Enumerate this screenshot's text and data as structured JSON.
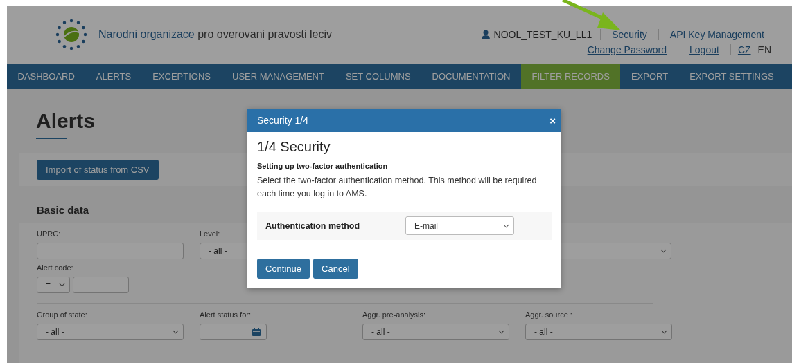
{
  "header": {
    "title_highlight": "Narodni organizace",
    "title_rest": "pro overovani pravosti leciv",
    "user": "NOOL_TEST_KU_LL1",
    "links_top": [
      "Security",
      "API Key Management"
    ],
    "links_bottom": [
      "Change Password",
      "Logout"
    ],
    "languages": [
      {
        "label": "CZ",
        "selected": false
      },
      {
        "label": "EN",
        "selected": true
      }
    ]
  },
  "nav": [
    {
      "label": "DASHBOARD",
      "selected": false
    },
    {
      "label": "ALERTS",
      "selected": false
    },
    {
      "label": "EXCEPTIONS",
      "selected": false
    },
    {
      "label": "USER MANAGEMENT",
      "selected": false
    },
    {
      "label": "SET COLUMNS",
      "selected": false
    },
    {
      "label": "DOCUMENTATION",
      "selected": false
    },
    {
      "label": "FILTER RECORDS",
      "selected": true
    },
    {
      "label": "EXPORT",
      "selected": false
    },
    {
      "label": "EXPORT SETTINGS",
      "selected": false
    }
  ],
  "page": {
    "title": "Alerts",
    "import_button": "Import of status from CSV",
    "section": "Basic data",
    "uprc": {
      "label": "UPRC:"
    },
    "level": {
      "label": "Level:",
      "value": "- all -"
    },
    "alert_code": {
      "label": "Alert code:",
      "operator": "="
    },
    "filters": [
      {
        "kind": "select",
        "label": "Group of state:",
        "value": "- all -"
      },
      {
        "kind": "date",
        "label": "Alert status for:"
      },
      {
        "kind": "select",
        "label": "Aggr. pre-analysis:",
        "value": "- all -"
      },
      {
        "kind": "select",
        "label": "Aggr. source :",
        "value": "- all -"
      }
    ]
  },
  "dialog": {
    "title": "Security 1/4",
    "close": "×",
    "heading": "1/4 Security",
    "subheading": "Setting up two-factor authentication",
    "text": "Select the two-factor authentication method. This method will be required each time you log in to AMS.",
    "method_label": "Authentication method",
    "method_value": "E-mail",
    "buttons": [
      "Continue",
      "Cancel"
    ]
  }
}
